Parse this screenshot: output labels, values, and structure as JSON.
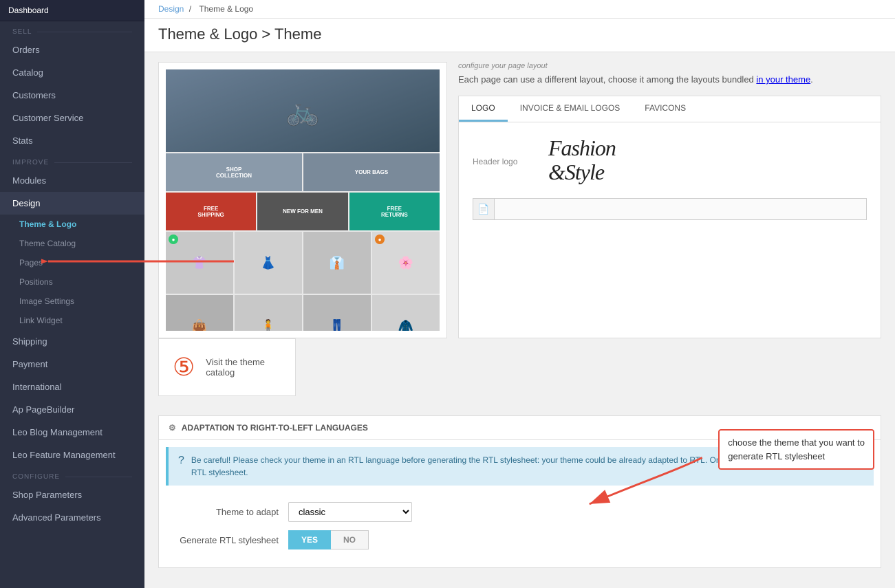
{
  "sidebar": {
    "dashboard_label": "Dashboard",
    "sell_label": "SELL",
    "orders_label": "Orders",
    "catalog_label": "Catalog",
    "customers_label": "Customers",
    "customer_service_label": "Customer Service",
    "stats_label": "Stats",
    "improve_label": "IMPROVE",
    "modules_label": "Modules",
    "design_label": "Design",
    "theme_logo_label": "Theme & Logo",
    "theme_catalog_label": "Theme Catalog",
    "pages_label": "Pages",
    "positions_label": "Positions",
    "image_settings_label": "Image Settings",
    "link_widget_label": "Link Widget",
    "shipping_label": "Shipping",
    "payment_label": "Payment",
    "international_label": "International",
    "ap_pagebuilder_label": "Ap PageBuilder",
    "leo_blog_label": "Leo Blog Management",
    "leo_feature_label": "Leo Feature Management",
    "configure_label": "CONFIGURE",
    "shop_params_label": "Shop Parameters",
    "advanced_params_label": "Advanced Parameters"
  },
  "breadcrumb": {
    "design": "Design",
    "separator": "/",
    "theme_logo": "Theme & Logo"
  },
  "page_title": "Theme & Logo > Theme",
  "tabs": {
    "logo": "LOGO",
    "invoice_email": "INVOICE & EMAIL LOGOS",
    "favicons": "FAVICONS"
  },
  "logo_section": {
    "header_logo_label": "Header logo"
  },
  "theme_catalog": {
    "label": "Visit the theme catalog"
  },
  "layout_section": {
    "configure_text": "configure your page layout",
    "description": "Each page can use a different layout, choose it among the layouts bundled",
    "description_link": "in your theme",
    "description_end": "."
  },
  "rtl_section": {
    "title": "ADAPTATION TO RIGHT-TO-LEFT LANGUAGES",
    "info_text": "Be careful! Please check your theme in an RTL language before generating the RTL stylesheet: your theme could be already adapted to RTL. Once you click on \"Adapt to RTL\", any RTL stylesheet.",
    "theme_to_adapt_label": "Theme to adapt",
    "theme_value": "classic",
    "generate_rtl_label": "Generate RTL stylesheet",
    "yes_btn": "YES",
    "no_btn": "NO"
  },
  "annotation": {
    "text": "choose the theme that you want to\ngenerate RTL stylesheet"
  },
  "preview_banners": [
    {
      "text": "SHOP COLLECTION"
    },
    {
      "text": "YOUR BAGS"
    },
    {
      "text": ""
    }
  ],
  "preview_bottom_banners": [
    {
      "text": "FREE SHIPPING"
    },
    {
      "text": "NEW FOR MEN"
    },
    {
      "text": "FREE RETURNS"
    }
  ]
}
